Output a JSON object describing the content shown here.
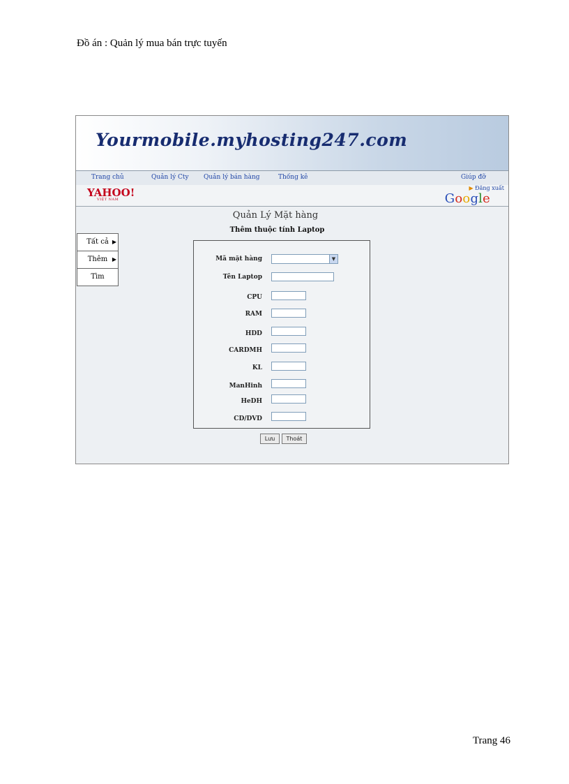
{
  "doc": {
    "header": "Đồ án : Quản lý mua bán trực tuyến",
    "footer": "Trang 46"
  },
  "site": {
    "banner_title": "Yourmobile.myhosting247.com",
    "nav": [
      "Trang chủ",
      "Quản lý Cty",
      "Quản lý bán hàng",
      "Thống kê",
      "Giúp đỡ"
    ],
    "logout": "Đăng xuất",
    "yahoo": "YAHOO!",
    "yahoo_sub": "VIỆT NAM",
    "google": [
      "G",
      "o",
      "o",
      "g",
      "l",
      "e"
    ]
  },
  "page": {
    "title": "Quản Lý Mặt hàng",
    "subtitle": "Thêm thuộc tính Laptop"
  },
  "side_menu": [
    {
      "label": "Tất cả",
      "arrow": "▶"
    },
    {
      "label": "Thêm",
      "arrow": "▶"
    },
    {
      "label": "Tìm",
      "arrow": ""
    }
  ],
  "form": {
    "fields": [
      {
        "label": "Mã mặt hàng",
        "value": ""
      },
      {
        "label": "Tên Laptop",
        "value": ""
      },
      {
        "label": "CPU",
        "value": ""
      },
      {
        "label": "RAM",
        "value": ""
      },
      {
        "label": "HDD",
        "value": ""
      },
      {
        "label": "CARDMH",
        "value": ""
      },
      {
        "label": "KL",
        "value": ""
      },
      {
        "label": "ManHinh",
        "value": ""
      },
      {
        "label": "HeDH",
        "value": ""
      },
      {
        "label": "CD/DVD",
        "value": ""
      }
    ],
    "save": "Lưu",
    "exit": "Thoát"
  }
}
